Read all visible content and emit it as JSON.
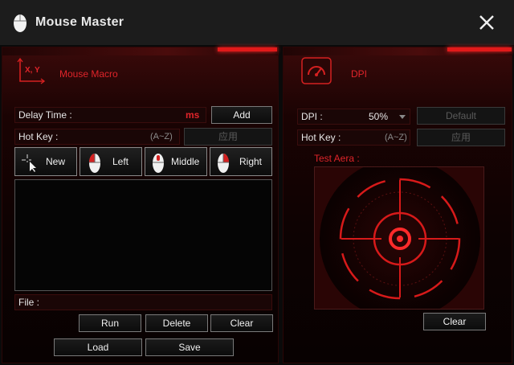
{
  "window": {
    "title": "Mouse Master"
  },
  "macro": {
    "heading": "Mouse Macro",
    "axis_label": "X, Y",
    "delay_label": "Delay Time :",
    "delay_unit": "ms",
    "add_label": "Add",
    "hotkey_label": "Hot Key :",
    "hotkey_hint": "(A~Z)",
    "apply_label": "应用",
    "buttons": {
      "new": "New",
      "left": "Left",
      "middle": "Middle",
      "right": "Right"
    },
    "file_label": "File :",
    "run_label": "Run",
    "delete_label": "Delete",
    "clear_label": "Clear",
    "load_label": "Load",
    "save_label": "Save"
  },
  "dpi": {
    "heading": "DPI",
    "dpi_label": "DPI :",
    "dpi_value": "50%",
    "default_label": "Default",
    "hotkey_label": "Hot Key :",
    "hotkey_hint": "(A~Z)",
    "apply_label": "应用",
    "test_area_label": "Test Aera :",
    "clear_label": "Clear"
  },
  "colors": {
    "accent": "#e0242a",
    "background": "#0a0a0a",
    "titlebar": "#1c1c1c"
  },
  "icons": [
    "mouse-icon",
    "close-icon",
    "xy-axis-icon",
    "speedometer-icon",
    "crosshair-icon",
    "cursor-icon",
    "chevron-down-icon"
  ]
}
